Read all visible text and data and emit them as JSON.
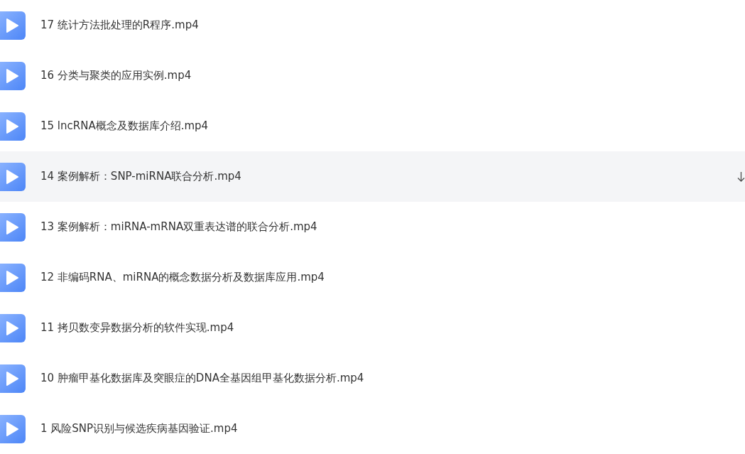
{
  "files": [
    {
      "name": "17 统计方法批处理的R程序.mp4",
      "hovered": false
    },
    {
      "name": "16 分类与聚类的应用实例.mp4",
      "hovered": false
    },
    {
      "name": "15 lncRNA概念及数据库介绍.mp4",
      "hovered": false
    },
    {
      "name": "14 案例解析：SNP-miRNA联合分析.mp4",
      "hovered": true
    },
    {
      "name": "13 案例解析：miRNA-mRNA双重表达谱的联合分析.mp4",
      "hovered": false
    },
    {
      "name": "12 非编码RNA、miRNA的概念数据分析及数据库应用.mp4",
      "hovered": false
    },
    {
      "name": "11 拷贝数变异数据分析的软件实现.mp4",
      "hovered": false
    },
    {
      "name": "10 肿瘤甲基化数据库及突眼症的DNA全基因组甲基化数据分析.mp4",
      "hovered": false
    },
    {
      "name": "1 风险SNP识别与候选疾病基因验证.mp4",
      "hovered": false
    }
  ]
}
